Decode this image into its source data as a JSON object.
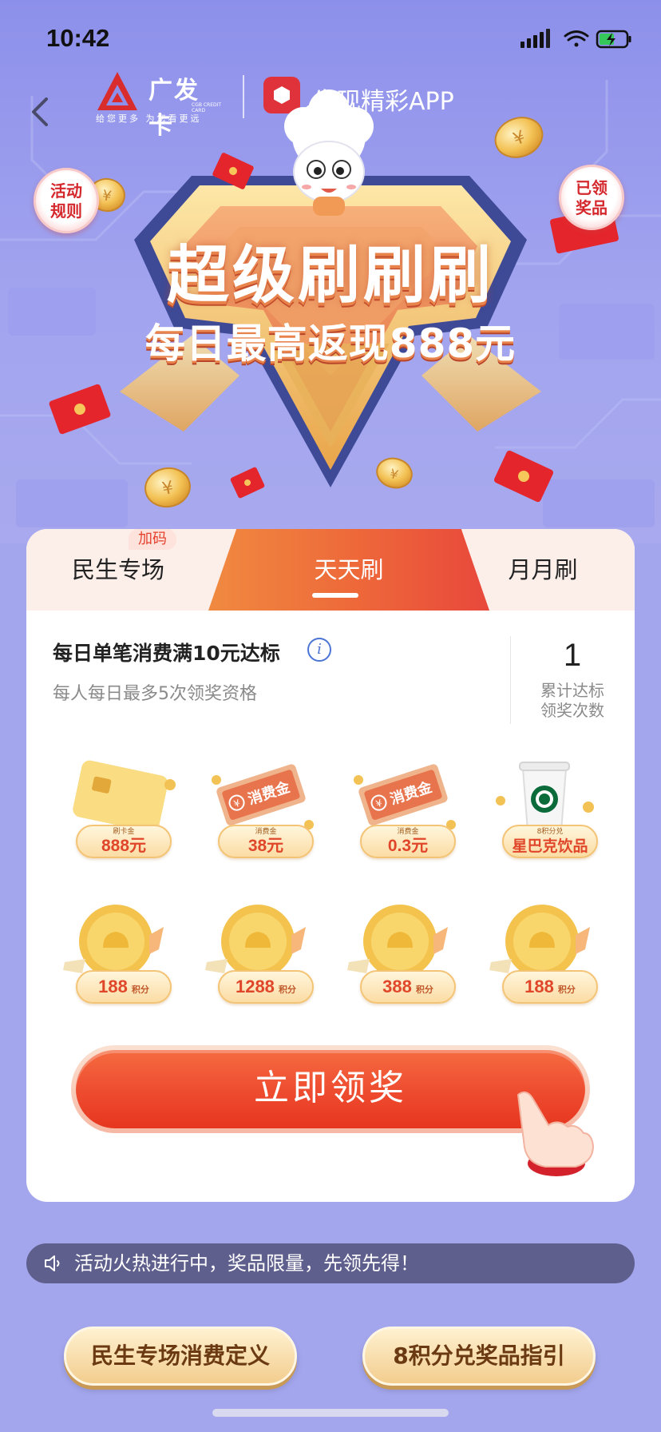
{
  "status_bar": {
    "time": "10:42"
  },
  "header": {
    "brand_name": "广发卡",
    "brand_slogan": "给您更多  为您看更远",
    "brand_en": "CGB CREDIT CARD",
    "partner_app": "发现精彩APP"
  },
  "side_buttons": {
    "rules": [
      "活动",
      "规则"
    ],
    "prizes": [
      "已领",
      "奖品"
    ]
  },
  "banner": {
    "title": "超级刷刷刷",
    "subtitle": "每日最高返现888元"
  },
  "tabs": [
    {
      "label": "民生专场",
      "badge": "加码"
    },
    {
      "label": "天天刷",
      "active": true
    },
    {
      "label": "月月刷"
    }
  ],
  "task": {
    "title": "每日单笔消费满10元达标",
    "subtitle": "每人每日最多5次领奖资格",
    "count": "1",
    "count_label": [
      "累计达标",
      "领奖次数"
    ]
  },
  "prizes": [
    {
      "type": "card",
      "small": "刷卡金",
      "big": "888元"
    },
    {
      "type": "ticket",
      "small": "消费金",
      "big": "38元",
      "ticket_text": "消费金"
    },
    {
      "type": "ticket",
      "small": "消费金",
      "big": "0.3元",
      "ticket_text": "消费金"
    },
    {
      "type": "coffee",
      "small": "8积分兑",
      "big": "星巴克饮品"
    },
    {
      "type": "coin",
      "big": "188",
      "unit": "积分"
    },
    {
      "type": "coin",
      "big": "1288",
      "unit": "积分"
    },
    {
      "type": "coin",
      "big": "388",
      "unit": "积分"
    },
    {
      "type": "coin",
      "big": "188",
      "unit": "积分"
    }
  ],
  "cta": {
    "label": "立即领奖"
  },
  "notice": {
    "text": "活动火热进行中，奖品限量，先领先得！"
  },
  "bottom_buttons": {
    "define": "民生专场消费定义",
    "guide": "8积分兑奖品指引"
  },
  "colors": {
    "accent": "#ee4b2f",
    "background": "#a3a6ec",
    "gold": "#f4c476"
  }
}
